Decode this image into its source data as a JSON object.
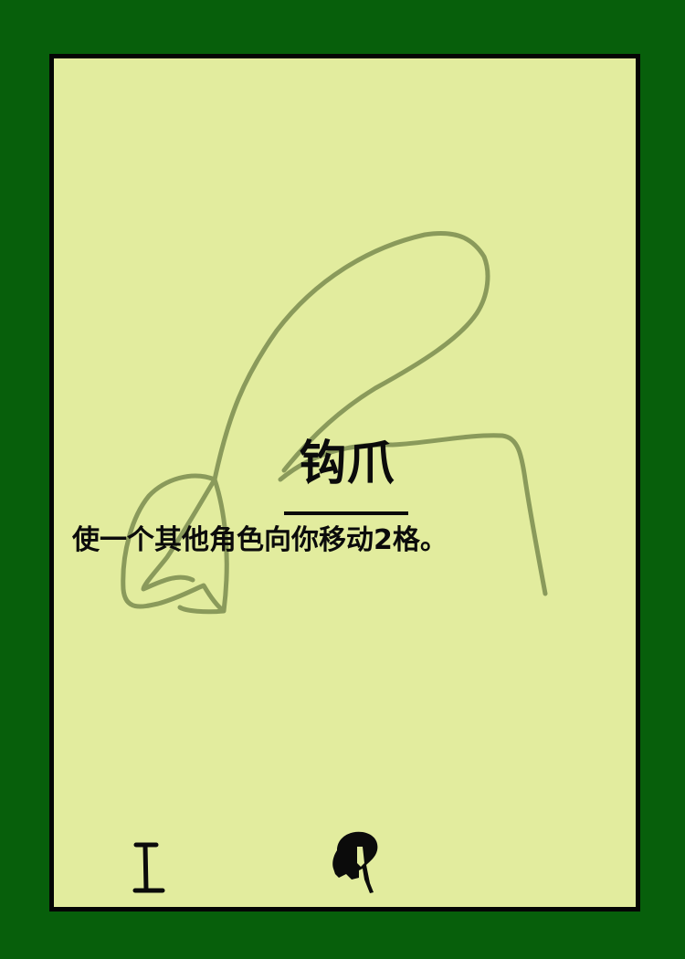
{
  "card": {
    "title": "钩爪",
    "effect_text": "使一个其他角色向你移动2格。",
    "level_numeral": "I",
    "level_icon": "roman-numeral-one-icon",
    "class_icon": "spartan-helmet-icon",
    "artwork": "grappling-hook-sketch"
  },
  "colors": {
    "background": "#075f0b",
    "card_face": "#e2ec9e",
    "border": "#050505",
    "sketch": "#8a9a5b",
    "text": "#0b0b0b"
  }
}
